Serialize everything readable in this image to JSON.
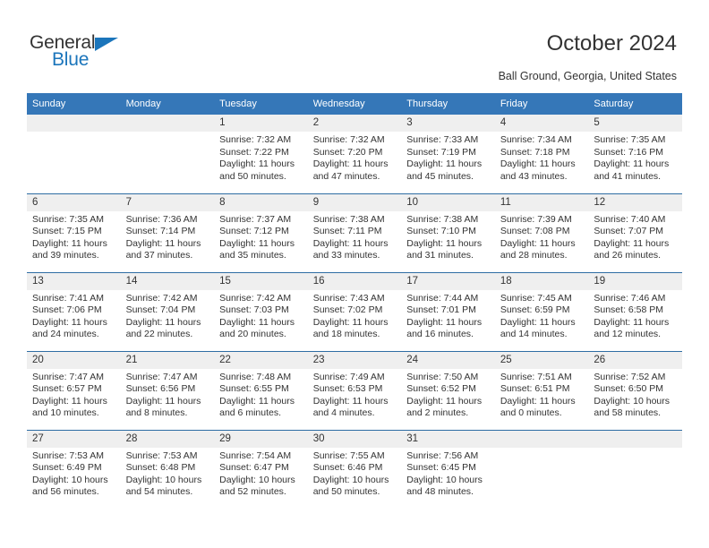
{
  "brand": {
    "name_top": "General",
    "name_bottom": "Blue",
    "triangle_icon": "triangle-right-icon",
    "accent_color": "#1b75bb"
  },
  "header": {
    "title": "October 2024",
    "subtitle": "Ball Ground, Georgia, United States"
  },
  "calendar": {
    "header_bg": "#3577b8",
    "row_border_color": "#2e6da4",
    "daynum_bg": "#efefef",
    "weekday_headers": [
      "Sunday",
      "Monday",
      "Tuesday",
      "Wednesday",
      "Thursday",
      "Friday",
      "Saturday"
    ],
    "weeks": [
      [
        {
          "day": "",
          "sunrise": "",
          "sunset": "",
          "daylight_line1": "",
          "daylight_line2": ""
        },
        {
          "day": "",
          "sunrise": "",
          "sunset": "",
          "daylight_line1": "",
          "daylight_line2": ""
        },
        {
          "day": "1",
          "sunrise": "Sunrise: 7:32 AM",
          "sunset": "Sunset: 7:22 PM",
          "daylight_line1": "Daylight: 11 hours",
          "daylight_line2": "and 50 minutes."
        },
        {
          "day": "2",
          "sunrise": "Sunrise: 7:32 AM",
          "sunset": "Sunset: 7:20 PM",
          "daylight_line1": "Daylight: 11 hours",
          "daylight_line2": "and 47 minutes."
        },
        {
          "day": "3",
          "sunrise": "Sunrise: 7:33 AM",
          "sunset": "Sunset: 7:19 PM",
          "daylight_line1": "Daylight: 11 hours",
          "daylight_line2": "and 45 minutes."
        },
        {
          "day": "4",
          "sunrise": "Sunrise: 7:34 AM",
          "sunset": "Sunset: 7:18 PM",
          "daylight_line1": "Daylight: 11 hours",
          "daylight_line2": "and 43 minutes."
        },
        {
          "day": "5",
          "sunrise": "Sunrise: 7:35 AM",
          "sunset": "Sunset: 7:16 PM",
          "daylight_line1": "Daylight: 11 hours",
          "daylight_line2": "and 41 minutes."
        }
      ],
      [
        {
          "day": "6",
          "sunrise": "Sunrise: 7:35 AM",
          "sunset": "Sunset: 7:15 PM",
          "daylight_line1": "Daylight: 11 hours",
          "daylight_line2": "and 39 minutes."
        },
        {
          "day": "7",
          "sunrise": "Sunrise: 7:36 AM",
          "sunset": "Sunset: 7:14 PM",
          "daylight_line1": "Daylight: 11 hours",
          "daylight_line2": "and 37 minutes."
        },
        {
          "day": "8",
          "sunrise": "Sunrise: 7:37 AM",
          "sunset": "Sunset: 7:12 PM",
          "daylight_line1": "Daylight: 11 hours",
          "daylight_line2": "and 35 minutes."
        },
        {
          "day": "9",
          "sunrise": "Sunrise: 7:38 AM",
          "sunset": "Sunset: 7:11 PM",
          "daylight_line1": "Daylight: 11 hours",
          "daylight_line2": "and 33 minutes."
        },
        {
          "day": "10",
          "sunrise": "Sunrise: 7:38 AM",
          "sunset": "Sunset: 7:10 PM",
          "daylight_line1": "Daylight: 11 hours",
          "daylight_line2": "and 31 minutes."
        },
        {
          "day": "11",
          "sunrise": "Sunrise: 7:39 AM",
          "sunset": "Sunset: 7:08 PM",
          "daylight_line1": "Daylight: 11 hours",
          "daylight_line2": "and 28 minutes."
        },
        {
          "day": "12",
          "sunrise": "Sunrise: 7:40 AM",
          "sunset": "Sunset: 7:07 PM",
          "daylight_line1": "Daylight: 11 hours",
          "daylight_line2": "and 26 minutes."
        }
      ],
      [
        {
          "day": "13",
          "sunrise": "Sunrise: 7:41 AM",
          "sunset": "Sunset: 7:06 PM",
          "daylight_line1": "Daylight: 11 hours",
          "daylight_line2": "and 24 minutes."
        },
        {
          "day": "14",
          "sunrise": "Sunrise: 7:42 AM",
          "sunset": "Sunset: 7:04 PM",
          "daylight_line1": "Daylight: 11 hours",
          "daylight_line2": "and 22 minutes."
        },
        {
          "day": "15",
          "sunrise": "Sunrise: 7:42 AM",
          "sunset": "Sunset: 7:03 PM",
          "daylight_line1": "Daylight: 11 hours",
          "daylight_line2": "and 20 minutes."
        },
        {
          "day": "16",
          "sunrise": "Sunrise: 7:43 AM",
          "sunset": "Sunset: 7:02 PM",
          "daylight_line1": "Daylight: 11 hours",
          "daylight_line2": "and 18 minutes."
        },
        {
          "day": "17",
          "sunrise": "Sunrise: 7:44 AM",
          "sunset": "Sunset: 7:01 PM",
          "daylight_line1": "Daylight: 11 hours",
          "daylight_line2": "and 16 minutes."
        },
        {
          "day": "18",
          "sunrise": "Sunrise: 7:45 AM",
          "sunset": "Sunset: 6:59 PM",
          "daylight_line1": "Daylight: 11 hours",
          "daylight_line2": "and 14 minutes."
        },
        {
          "day": "19",
          "sunrise": "Sunrise: 7:46 AM",
          "sunset": "Sunset: 6:58 PM",
          "daylight_line1": "Daylight: 11 hours",
          "daylight_line2": "and 12 minutes."
        }
      ],
      [
        {
          "day": "20",
          "sunrise": "Sunrise: 7:47 AM",
          "sunset": "Sunset: 6:57 PM",
          "daylight_line1": "Daylight: 11 hours",
          "daylight_line2": "and 10 minutes."
        },
        {
          "day": "21",
          "sunrise": "Sunrise: 7:47 AM",
          "sunset": "Sunset: 6:56 PM",
          "daylight_line1": "Daylight: 11 hours",
          "daylight_line2": "and 8 minutes."
        },
        {
          "day": "22",
          "sunrise": "Sunrise: 7:48 AM",
          "sunset": "Sunset: 6:55 PM",
          "daylight_line1": "Daylight: 11 hours",
          "daylight_line2": "and 6 minutes."
        },
        {
          "day": "23",
          "sunrise": "Sunrise: 7:49 AM",
          "sunset": "Sunset: 6:53 PM",
          "daylight_line1": "Daylight: 11 hours",
          "daylight_line2": "and 4 minutes."
        },
        {
          "day": "24",
          "sunrise": "Sunrise: 7:50 AM",
          "sunset": "Sunset: 6:52 PM",
          "daylight_line1": "Daylight: 11 hours",
          "daylight_line2": "and 2 minutes."
        },
        {
          "day": "25",
          "sunrise": "Sunrise: 7:51 AM",
          "sunset": "Sunset: 6:51 PM",
          "daylight_line1": "Daylight: 11 hours",
          "daylight_line2": "and 0 minutes."
        },
        {
          "day": "26",
          "sunrise": "Sunrise: 7:52 AM",
          "sunset": "Sunset: 6:50 PM",
          "daylight_line1": "Daylight: 10 hours",
          "daylight_line2": "and 58 minutes."
        }
      ],
      [
        {
          "day": "27",
          "sunrise": "Sunrise: 7:53 AM",
          "sunset": "Sunset: 6:49 PM",
          "daylight_line1": "Daylight: 10 hours",
          "daylight_line2": "and 56 minutes."
        },
        {
          "day": "28",
          "sunrise": "Sunrise: 7:53 AM",
          "sunset": "Sunset: 6:48 PM",
          "daylight_line1": "Daylight: 10 hours",
          "daylight_line2": "and 54 minutes."
        },
        {
          "day": "29",
          "sunrise": "Sunrise: 7:54 AM",
          "sunset": "Sunset: 6:47 PM",
          "daylight_line1": "Daylight: 10 hours",
          "daylight_line2": "and 52 minutes."
        },
        {
          "day": "30",
          "sunrise": "Sunrise: 7:55 AM",
          "sunset": "Sunset: 6:46 PM",
          "daylight_line1": "Daylight: 10 hours",
          "daylight_line2": "and 50 minutes."
        },
        {
          "day": "31",
          "sunrise": "Sunrise: 7:56 AM",
          "sunset": "Sunset: 6:45 PM",
          "daylight_line1": "Daylight: 10 hours",
          "daylight_line2": "and 48 minutes."
        },
        {
          "day": "",
          "sunrise": "",
          "sunset": "",
          "daylight_line1": "",
          "daylight_line2": ""
        },
        {
          "day": "",
          "sunrise": "",
          "sunset": "",
          "daylight_line1": "",
          "daylight_line2": ""
        }
      ]
    ]
  }
}
